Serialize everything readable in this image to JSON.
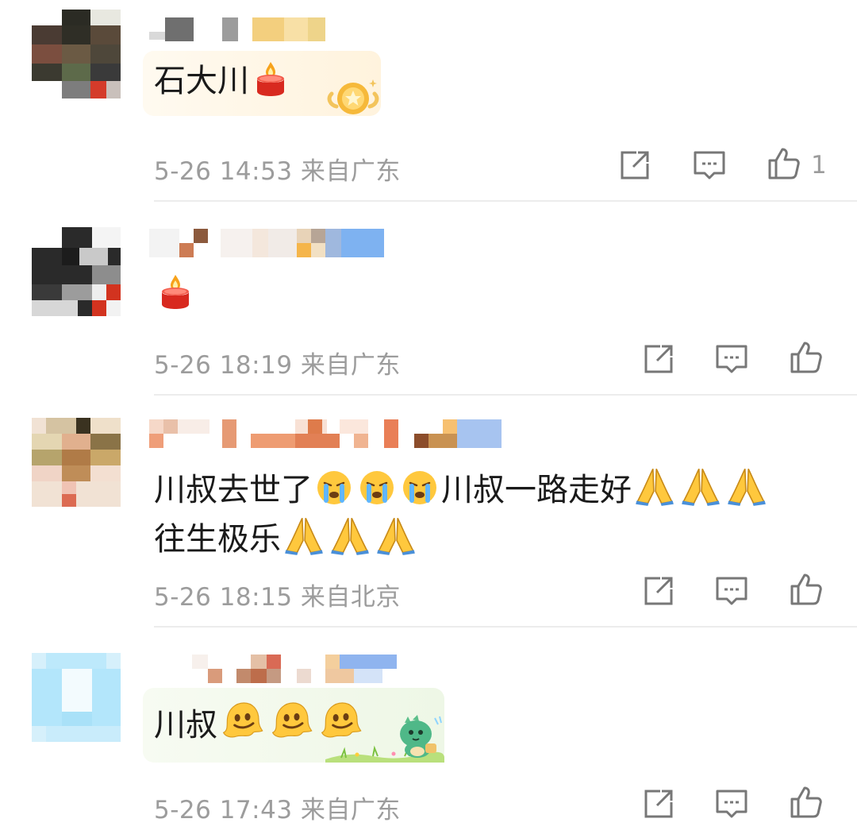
{
  "comments": [
    {
      "text_prefix": "石大川",
      "emojis": [
        "candle"
      ],
      "timestamp": "5-26 14:53",
      "location": "来自广东",
      "like_count": "1",
      "badge": "star-badge"
    },
    {
      "text_prefix": "",
      "emojis": [
        "candle"
      ],
      "timestamp": "5-26 18:19",
      "location": "来自广东",
      "like_count": ""
    },
    {
      "line1_a": "川叔去世了",
      "line1_b": "川叔一路走好",
      "line2": "往生极乐",
      "emojis": [
        "crying-face",
        "crying-face",
        "crying-face",
        "praying-hands",
        "praying-hands",
        "praying-hands",
        "praying-hands",
        "praying-hands",
        "praying-hands"
      ],
      "timestamp": "5-26 18:15",
      "location": "来自北京",
      "like_count": ""
    },
    {
      "text_prefix": "川叔",
      "emojis": [
        "melting-face",
        "melting-face",
        "melting-face"
      ],
      "timestamp": "5-26 17:43",
      "location": "来自广东",
      "like_count": "",
      "sticker": "green-dinosaur"
    }
  ],
  "colors": {
    "meta_gray": "#9c9c9c",
    "divider": "#ececec",
    "text": "#1a1a1a"
  },
  "icons": {
    "share": "share-icon",
    "reply": "comment-icon",
    "like": "thumbs-up-icon"
  }
}
